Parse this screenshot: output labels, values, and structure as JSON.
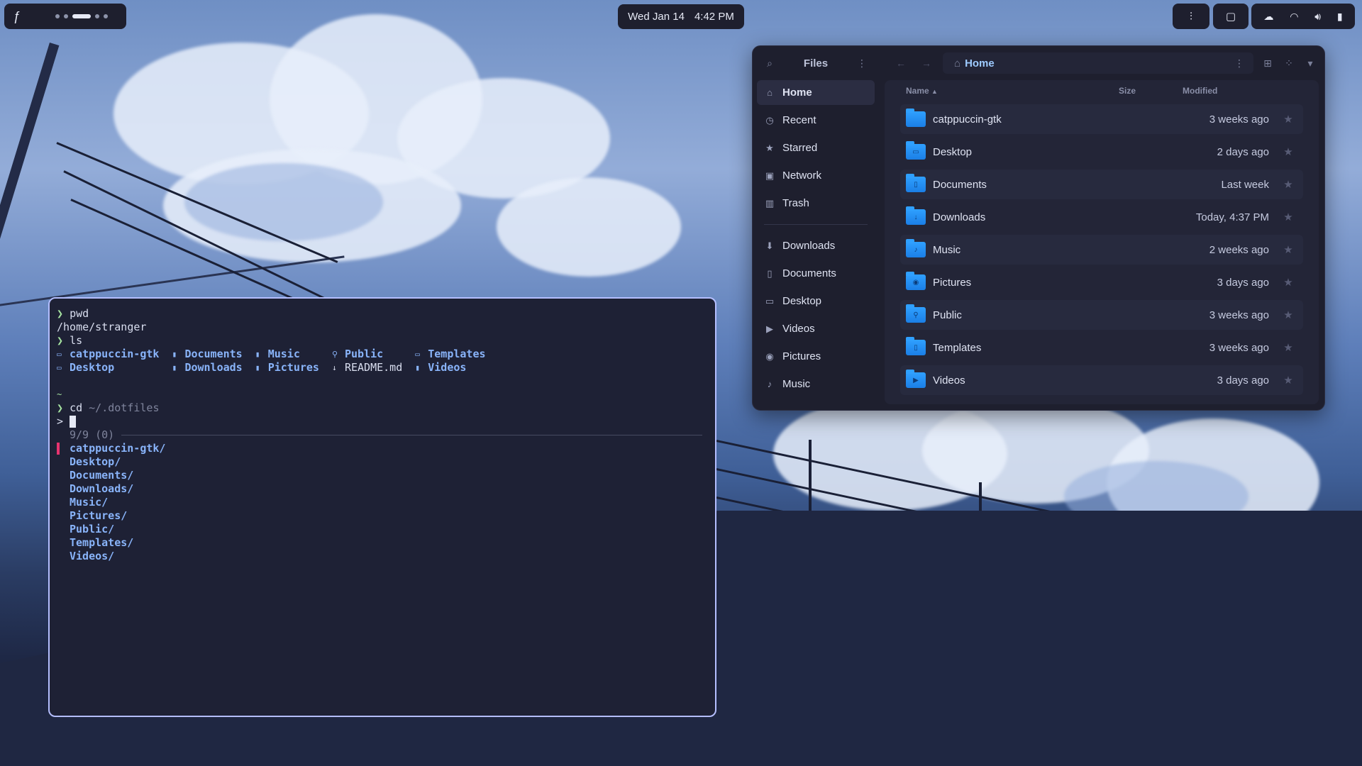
{
  "topbar": {
    "workspace_logo": "fedora-logo-icon",
    "workspaces": [
      false,
      false,
      true,
      false,
      false
    ],
    "date": "Wed Jan 14",
    "time": "4:42 PM",
    "tray_icons": [
      "equalizer-icon",
      "clipboard-icon"
    ],
    "status_icons": [
      "cloud-icon",
      "wifi-icon",
      "volume-icon",
      "battery-icon"
    ]
  },
  "files": {
    "title": "Files",
    "location": "Home",
    "sidebar_places": [
      {
        "label": "Home",
        "icon": "home-icon",
        "active": true
      },
      {
        "label": "Recent",
        "icon": "clock-icon"
      },
      {
        "label": "Starred",
        "icon": "star-icon"
      },
      {
        "label": "Network",
        "icon": "network-icon"
      },
      {
        "label": "Trash",
        "icon": "trash-icon"
      }
    ],
    "sidebar_bookmarks": [
      {
        "label": "Downloads",
        "icon": "download-icon"
      },
      {
        "label": "Documents",
        "icon": "document-icon"
      },
      {
        "label": "Desktop",
        "icon": "folder-icon"
      },
      {
        "label": "Videos",
        "icon": "video-icon"
      },
      {
        "label": "Pictures",
        "icon": "camera-icon"
      },
      {
        "label": "Music",
        "icon": "music-icon"
      }
    ],
    "columns": {
      "name": "Name",
      "size": "Size",
      "modified": "Modified"
    },
    "rows": [
      {
        "name": "catppuccin-gtk",
        "modified": "3 weeks ago",
        "glyph": ""
      },
      {
        "name": "Desktop",
        "modified": "2 days ago",
        "glyph": "▭"
      },
      {
        "name": "Documents",
        "modified": "Last week",
        "glyph": "▯"
      },
      {
        "name": "Downloads",
        "modified": "Today, 4:37 PM",
        "glyph": "↓"
      },
      {
        "name": "Music",
        "modified": "2 weeks ago",
        "glyph": "♪"
      },
      {
        "name": "Pictures",
        "modified": "3 days ago",
        "glyph": "◉"
      },
      {
        "name": "Public",
        "modified": "3 weeks ago",
        "glyph": "⚲"
      },
      {
        "name": "Templates",
        "modified": "3 weeks ago",
        "glyph": "▯"
      },
      {
        "name": "Videos",
        "modified": "3 days ago",
        "glyph": "▶"
      }
    ]
  },
  "terminal": {
    "prompt_symbol": "❯",
    "cmd1": "pwd",
    "out1": "/home/stranger",
    "cmd2": "ls",
    "ls_columns": [
      [
        {
          "icon": "▭",
          "name": "catppuccin-gtk"
        },
        {
          "icon": "▭",
          "name": "Desktop"
        }
      ],
      [
        {
          "icon": "▮",
          "name": "Documents"
        },
        {
          "icon": "▮",
          "name": "Downloads"
        }
      ],
      [
        {
          "icon": "▮",
          "name": "Music"
        },
        {
          "icon": "▮",
          "name": "Pictures"
        }
      ],
      [
        {
          "icon": "⚲",
          "name": "Public"
        },
        {
          "icon": "↓",
          "name": "README.md",
          "plain": true
        }
      ],
      [
        {
          "icon": "▭",
          "name": "Templates"
        },
        {
          "icon": "▮",
          "name": "Videos"
        }
      ]
    ],
    "tilde": "~",
    "cmd3": "cd",
    "cmd3_arg": "~/.dotfiles",
    "fzf_prompt": ">",
    "fzf_count": "9/9 (0)",
    "fzf_items": [
      "catppuccin-gtk/",
      "Desktop/",
      "Documents/",
      "Downloads/",
      "Music/",
      "Pictures/",
      "Public/",
      "Templates/",
      "Videos/"
    ]
  }
}
